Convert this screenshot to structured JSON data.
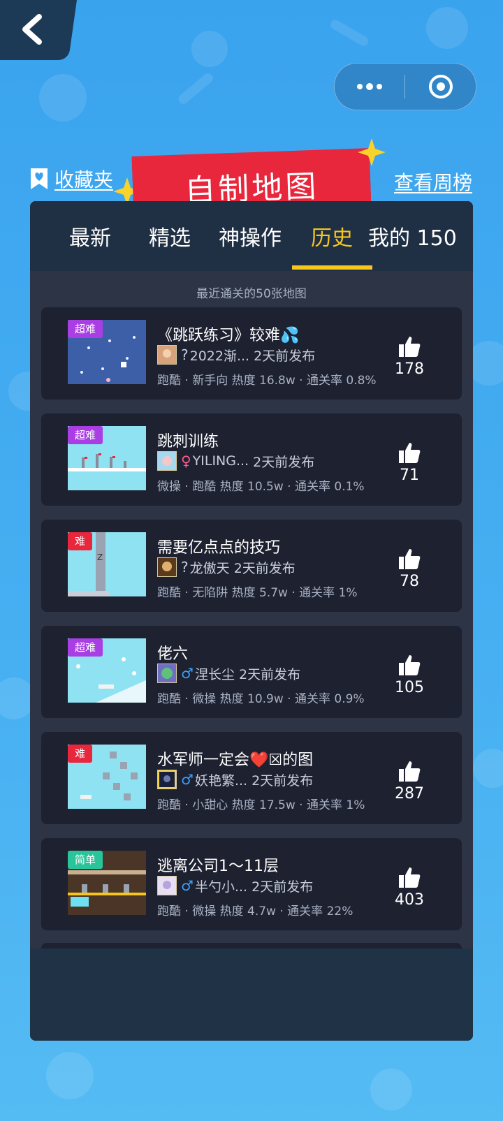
{
  "header": {
    "back_label": "",
    "favorites_label": "收藏夹",
    "title": "自制地图",
    "weekly_label": "查看周榜"
  },
  "tabs": [
    {
      "label": "最新",
      "active": false
    },
    {
      "label": "精选",
      "active": false
    },
    {
      "label": "神操作",
      "active": false
    },
    {
      "label": "历史",
      "active": true
    },
    {
      "label": "我的 150",
      "active": false
    }
  ],
  "caption": "最近通关的50张地图",
  "colors": {
    "accent": "#f7c61d",
    "banner": "#e8263c",
    "panel": "#2c3446",
    "card": "#1d2130"
  },
  "maps": [
    {
      "difficulty": "超难",
      "badge_color": "purple",
      "title": "《跳跃练习》较难💦",
      "gender": "?",
      "author": "2022渐...",
      "published": "2天前发布",
      "stats": "跑酷 · 新手向 热度 16.8w · 通关率 0.8%",
      "likes": "178"
    },
    {
      "difficulty": "超难",
      "badge_color": "purple",
      "title": "跳刺训练",
      "gender": "♀",
      "author": "YILING...",
      "published": "2天前发布",
      "stats": "微操 · 跑酷 热度 10.5w · 通关率 0.1%",
      "likes": "71"
    },
    {
      "difficulty": "难",
      "badge_color": "red",
      "title": "需要亿点点的技巧",
      "gender": "?",
      "author": "龙傲天",
      "published": "2天前发布",
      "stats": "跑酷 · 无陷阱 热度 5.7w · 通关率 1%",
      "likes": "78"
    },
    {
      "difficulty": "超难",
      "badge_color": "purple",
      "title": "佬六",
      "gender": "♂",
      "author": "涅长尘",
      "published": "2天前发布",
      "stats": "跑酷 · 微操 热度 10.9w · 通关率 0.9%",
      "likes": "105"
    },
    {
      "difficulty": "难",
      "badge_color": "red",
      "title": "水军师一定会❤️☒的图",
      "gender": "♂",
      "author": "妖艳繁...",
      "published": "2天前发布",
      "stats": "跑酷 · 小甜心 热度 17.5w · 通关率 1%",
      "likes": "287"
    },
    {
      "difficulty": "简单",
      "badge_color": "green",
      "title": "逃离公司1～11层",
      "gender": "♂",
      "author": "半勺小...",
      "published": "2天前发布",
      "stats": "跑酷 · 微操 热度 4.7w · 通关率 22%",
      "likes": "403"
    }
  ]
}
